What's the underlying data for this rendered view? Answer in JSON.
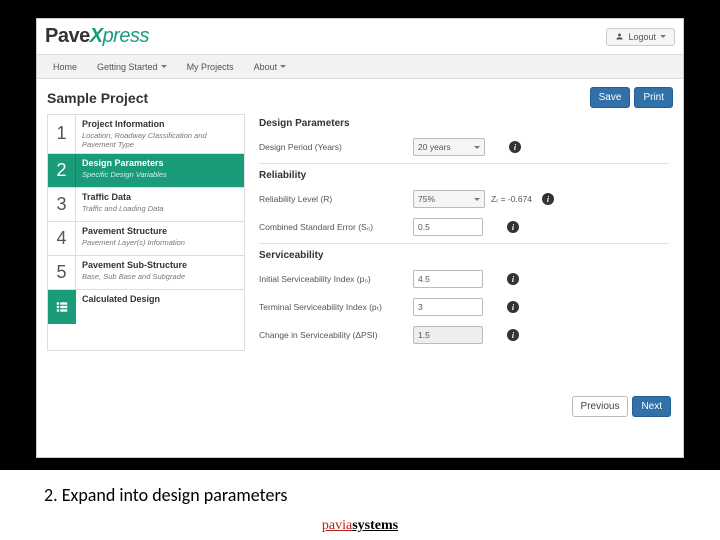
{
  "logo": {
    "pave": "Pave",
    "x": "X",
    "press": "press"
  },
  "logout": "Logout",
  "nav": {
    "home": "Home",
    "getting_started": "Getting Started",
    "my_projects": "My Projects",
    "about": "About"
  },
  "page_title": "Sample Project",
  "buttons": {
    "save": "Save",
    "print": "Print",
    "previous": "Previous",
    "next": "Next"
  },
  "steps": [
    {
      "num": "1",
      "title": "Project Information",
      "sub": "Location, Roadway Classification and Pavement Type"
    },
    {
      "num": "2",
      "title": "Design Parameters",
      "sub": "Specific Design Variables"
    },
    {
      "num": "3",
      "title": "Traffic Data",
      "sub": "Traffic and Loading Data"
    },
    {
      "num": "4",
      "title": "Pavement Structure",
      "sub": "Pavement Layer(s) Information"
    },
    {
      "num": "5",
      "title": "Pavement Sub-Structure",
      "sub": "Base, Sub Base and Subgrade"
    },
    {
      "num": "",
      "title": "Calculated Design",
      "sub": ""
    }
  ],
  "sections": {
    "design_params": "Design Parameters",
    "reliability": "Reliability",
    "serviceability": "Serviceability"
  },
  "fields": {
    "design_period_label": "Design Period (Years)",
    "design_period_value": "20 years",
    "reliability_label": "Reliability Level (R)",
    "reliability_value": "75%",
    "reliability_extra": "Zᵣ = -0.674",
    "std_error_label": "Combined Standard Error (S₀)",
    "std_error_value": "0.5",
    "initial_psi_label": "Initial Serviceability Index (p₀)",
    "initial_psi_value": "4.5",
    "terminal_psi_label": "Terminal Serviceability Index (pₜ)",
    "terminal_psi_value": "3",
    "delta_psi_label": "Change in Serviceability (ΔPSI)",
    "delta_psi_value": "1.5"
  },
  "caption": "2. Expand into design parameters",
  "footer": {
    "pavia": "pavia",
    "systems": "systems"
  }
}
